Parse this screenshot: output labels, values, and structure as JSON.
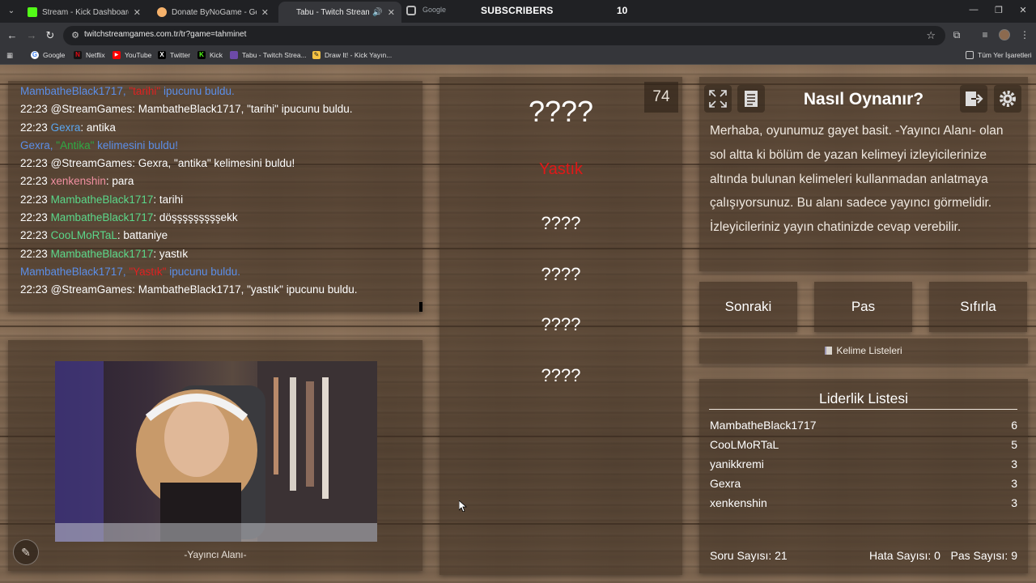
{
  "browser": {
    "tabs": [
      {
        "title": "Stream - Kick Dashboard",
        "color": "#53fc18",
        "active": false
      },
      {
        "title": "Donate ByNoGame - Gelen/Gid",
        "color": "#f6b26b",
        "active": false
      },
      {
        "title": "Tabu - Twitch Stream Game",
        "color": "#6d4aa8",
        "active": true
      }
    ],
    "overlay": {
      "google_label": "Google",
      "subs_label": "SUBSCRIBERS",
      "subs_count": "10"
    },
    "url": "twitchstreamgames.com.tr/tr?game=tahminet",
    "bookmarks": [
      {
        "label": "Google",
        "icon": "G",
        "color": "#ffffff"
      },
      {
        "label": "Netflix",
        "icon": "N",
        "color": "#e50914"
      },
      {
        "label": "YouTube",
        "icon": "▶",
        "color": "#ff0000"
      },
      {
        "label": "Twitter",
        "icon": "X",
        "color": "#000000"
      },
      {
        "label": "Kick",
        "icon": "K",
        "color": "#53fc18"
      },
      {
        "label": "Tabu - Twitch Strea...",
        "icon": "",
        "color": "#6d4aa8"
      },
      {
        "label": "Draw It! - Kick Yayın...",
        "icon": "✎",
        "color": "#f6c343"
      }
    ],
    "all_bookmarks": "Tüm Yer İşaretleri"
  },
  "chat": {
    "lines": [
      {
        "type": "sys",
        "user": "MambatheBlack1717,",
        "word": "\"tarihi\"",
        "word_color": "red",
        "rest": "ipucunu buldu."
      },
      {
        "type": "msg",
        "time": "22:23",
        "user": "@StreamGames",
        "user_color": "white",
        "text": ": MambatheBlack1717, \"tarihi\" ipucunu buldu."
      },
      {
        "type": "msg",
        "time": "22:23",
        "user": "Gexra",
        "user_color": "blue",
        "text": ": antika"
      },
      {
        "type": "sys",
        "user": "Gexra,",
        "word": "\"Antika\"",
        "word_color": "green",
        "rest": "kelimesini buldu!"
      },
      {
        "type": "msg",
        "time": "22:23",
        "user": "@StreamGames",
        "user_color": "white",
        "text": ": Gexra, \"antika\" kelimesini buldu!"
      },
      {
        "type": "msg",
        "time": "22:23",
        "user": "xenkenshin",
        "user_color": "pink",
        "text": ": para"
      },
      {
        "type": "msg",
        "time": "22:23",
        "user": "MambatheBlack1717",
        "user_color": "green",
        "text": ": tarihi"
      },
      {
        "type": "msg",
        "time": "22:23",
        "user": "MambatheBlack1717",
        "user_color": "green",
        "text": ": döşşşşşşşşşekk"
      },
      {
        "type": "msg",
        "time": "22:23",
        "user": "CooLMoRTaL",
        "user_color": "green",
        "text": ": battaniye"
      },
      {
        "type": "msg",
        "time": "22:23",
        "user": "MambatheBlack1717",
        "user_color": "green",
        "text": ": yastık"
      },
      {
        "type": "sys",
        "user": "MambatheBlack1717,",
        "word": "\"Yastık\"",
        "word_color": "red",
        "rest": "ipucunu buldu."
      },
      {
        "type": "msg",
        "time": "22:23",
        "user": "@StreamGames",
        "user_color": "white",
        "text": ": MambatheBlack1717, \"yastık\" ipucunu buldu."
      }
    ]
  },
  "streamer": {
    "label": "-Yayıncı Alanı-"
  },
  "words": {
    "counter": "74",
    "main": "????",
    "revealed": "Yastık",
    "hidden": [
      "????",
      "????",
      "????",
      "????"
    ]
  },
  "howto": {
    "title": "Nasıl Oynanır?",
    "text": "Merhaba, oyunumuz gayet basit. -Yayıncı Alanı- olan sol altta ki bölüm de yazan kelimeyi izleyicilerinize altında bulunan kelimeleri kullanmadan anlatmaya çalışıyorsunuz. Bu alanı sadece yayıncı görmelidir. İzleyicileriniz yayın chatinizde cevap verebilir."
  },
  "buttons": {
    "next": "Sonraki",
    "pass": "Pas",
    "reset": "Sıfırla",
    "word_lists": "Kelime Listeleri"
  },
  "leaderboard": {
    "title": "Liderlik Listesi",
    "rows": [
      {
        "name": "MambatheBlack1717",
        "score": "6"
      },
      {
        "name": "CooLMoRTaL",
        "score": "5"
      },
      {
        "name": "yanikkremi",
        "score": "3"
      },
      {
        "name": "Gexra",
        "score": "3"
      },
      {
        "name": "xenkenshin",
        "score": "3"
      }
    ]
  },
  "stats": {
    "questions": "Soru Sayısı: 21",
    "errors": "Hata Sayısı: 0",
    "passes": "Pas Sayısı: 9"
  }
}
